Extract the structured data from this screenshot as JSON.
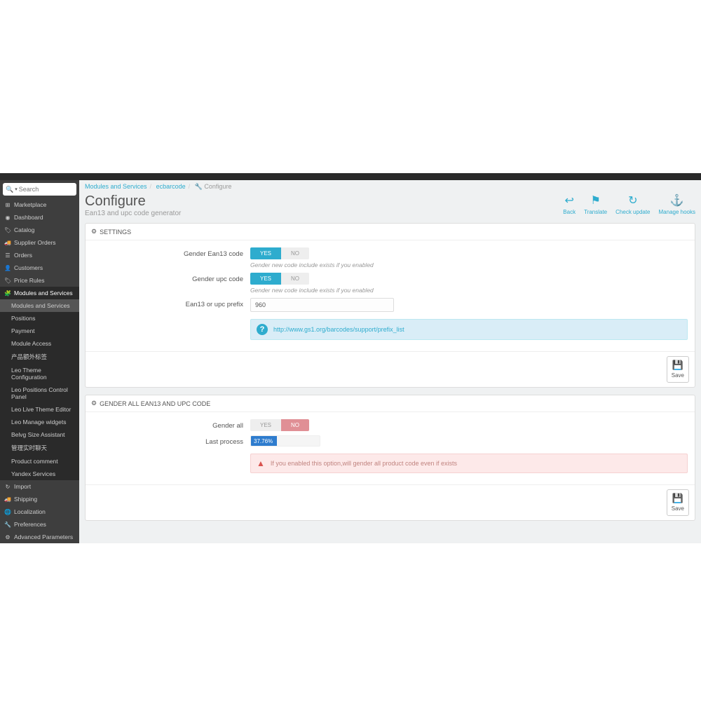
{
  "search": {
    "placeholder": "Search"
  },
  "sidebar": {
    "items": [
      {
        "icon": "⊞",
        "label": "Marketplace"
      },
      {
        "icon": "◉",
        "label": "Dashboard"
      },
      {
        "icon": "🏷",
        "label": "Catalog"
      },
      {
        "icon": "🚚",
        "label": "Supplier Orders"
      },
      {
        "icon": "☰",
        "label": "Orders"
      },
      {
        "icon": "👤",
        "label": "Customers"
      },
      {
        "icon": "🏷",
        "label": "Price Rules"
      },
      {
        "icon": "🧩",
        "label": "Modules and Services"
      },
      {
        "icon": "↻",
        "label": "Import"
      },
      {
        "icon": "🚚",
        "label": "Shipping"
      },
      {
        "icon": "🌐",
        "label": "Localization"
      },
      {
        "icon": "🔧",
        "label": "Preferences"
      },
      {
        "icon": "⚙",
        "label": "Advanced Parameters"
      }
    ],
    "sub": [
      "Modules and Services",
      "Positions",
      "Payment",
      "Module Access",
      "产品额外标签",
      "Leo Theme Configuration",
      "Leo Positions Control Panel",
      "Leo Live Theme Editor",
      "Leo Manage widgets",
      "Belvg Size Assistant",
      "管理实时聊天",
      "Product comment",
      "Yandex Services"
    ]
  },
  "crumbs": {
    "a": "Modules and Services",
    "b": "ecbarcode",
    "c": "Configure"
  },
  "page": {
    "title": "Configure",
    "sub": "Ean13 and upc code generator"
  },
  "toolbar": {
    "back": "Back",
    "translate": "Translate",
    "check": "Check update",
    "hooks": "Manage hooks"
  },
  "panel1": {
    "title": "SETTINGS",
    "f1": {
      "label": "Gender Ean13 code",
      "yes": "YES",
      "no": "NO",
      "help": "Gender new code include exists if you enabled"
    },
    "f2": {
      "label": "Gender upc code",
      "yes": "YES",
      "no": "NO",
      "help": "Gender new code include exists if you enabled"
    },
    "f3": {
      "label": "Ean13 or upc prefix",
      "value": "960"
    },
    "link": "http://www.gs1.org/barcodes/support/prefix_list",
    "save": "Save"
  },
  "panel2": {
    "title": "GENDER ALL EAN13 AND UPC CODE",
    "f1": {
      "label": "Gender all",
      "yes": "YES",
      "no": "NO"
    },
    "f2": {
      "label": "Last process",
      "pct": "37.76%",
      "width": "37.76%"
    },
    "warn": "If you enabled this option,will gender all product code even if exists",
    "save": "Save"
  }
}
